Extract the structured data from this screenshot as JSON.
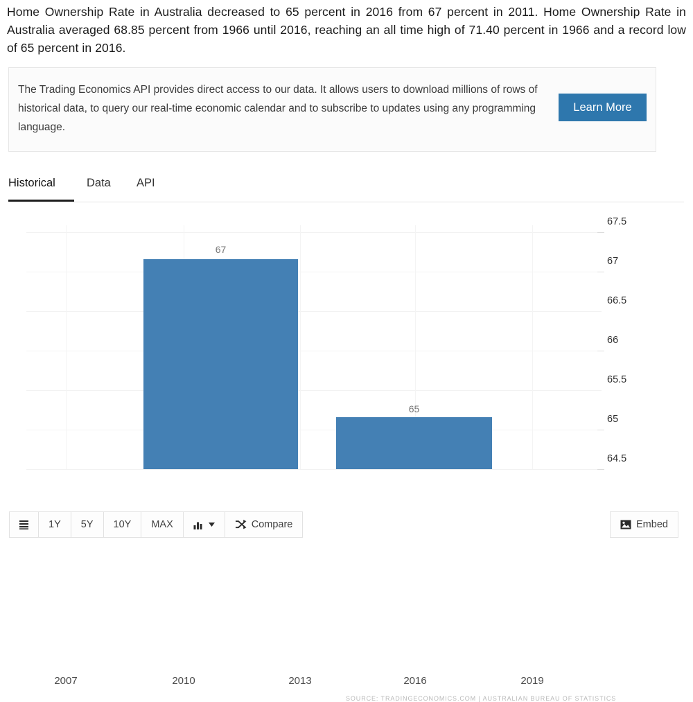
{
  "intro": {
    "text": "Home Ownership Rate in Australia decreased to 65 percent in 2016 from 67 percent in 2011. Home Ownership Rate in Australia averaged 68.85 percent from 1966 until 2016, reaching an all time high of 71.40 percent in 1966 and a record low of 65 percent in 2016."
  },
  "api_panel": {
    "text": "The Trading Economics API provides direct access to our data. It allows users to download millions of rows of historical data, to query our real-time economic calendar and to subscribe to updates using any programming language.",
    "button_label": "Learn More",
    "button_color": "#2e77ad"
  },
  "tabs": [
    {
      "label": "Historical",
      "active": true
    },
    {
      "label": "Data",
      "active": false
    },
    {
      "label": "API",
      "active": false
    }
  ],
  "chart_data": {
    "type": "bar",
    "title": "",
    "subtitle": "",
    "xlabel": "",
    "ylabel": "",
    "x": [
      2011,
      2016
    ],
    "categories": [
      "2011",
      "2016"
    ],
    "values": [
      67,
      65
    ],
    "data_labels": [
      "67",
      "65"
    ],
    "series": [
      {
        "name": "Home Ownership Rate in Australia",
        "values": [
          67,
          65
        ]
      }
    ],
    "ylim": [
      64.5,
      67.5
    ],
    "yticks": [
      "67.5",
      "67",
      "66.5",
      "66",
      "65.5",
      "65",
      "64.5"
    ],
    "xticks": [
      "2007",
      "2010",
      "2013",
      "2016",
      "2019"
    ],
    "xlim": [
      2006,
      2020.5
    ],
    "grid": true,
    "legend": false,
    "bar_color": "#4480b4",
    "source": "SOURCE: TRADINGECONOMICS.COM | AUSTRALIAN BUREAU OF STATISTICS"
  },
  "toolbar": {
    "menu_icon": "list-icon",
    "ranges": [
      "1Y",
      "5Y",
      "10Y",
      "MAX"
    ],
    "chart_type_icon": "bar-chart-icon",
    "chart_type_caret": "▾",
    "compare_icon": "shuffle-icon",
    "compare_label": "Compare",
    "embed_icon": "image-icon",
    "embed_label": "Embed"
  }
}
